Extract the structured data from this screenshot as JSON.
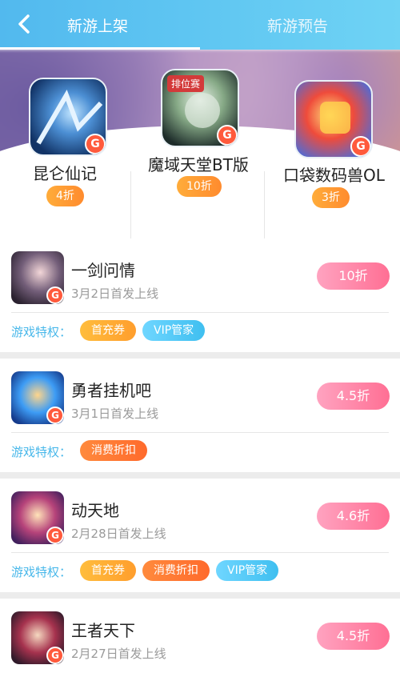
{
  "header": {
    "tabs": [
      "新游上架",
      "新游预告"
    ],
    "active_tab": 0
  },
  "featured": [
    {
      "name": "昆仑仙记",
      "discount": "4折",
      "badge": "G"
    },
    {
      "name": "魔域天堂BT版",
      "discount": "10折",
      "badge": "G",
      "tag": "排位赛"
    },
    {
      "name": "口袋数码兽OL",
      "discount": "3折",
      "badge": "G"
    }
  ],
  "cards": [
    {
      "name": "一剑问情",
      "date": "3月2日首发上线",
      "discount": "10折",
      "perk_label": "游戏特权：",
      "perks": [
        "首充券",
        "VIP管家"
      ]
    },
    {
      "name": "勇者挂机吧",
      "date": "3月1日首发上线",
      "discount": "4.5折",
      "perk_label": "游戏特权：",
      "perks": [
        "消费折扣"
      ]
    },
    {
      "name": "动天地",
      "date": "2月28日首发上线",
      "discount": "4.6折",
      "perk_label": "游戏特权：",
      "perks": [
        "首充券",
        "消费折扣",
        "VIP管家"
      ]
    },
    {
      "name": "王者天下",
      "date": "2月27日首发上线",
      "discount": "4.5折"
    }
  ],
  "colors": {
    "header_start": "#52b9ee",
    "pill_pink_start": "#ffa3c0",
    "pill_pink_end": "#ff6f94",
    "perk_orange": "#ffa52d",
    "perk_deep_orange": "#ff7a2f",
    "perk_blue": "#49c5f3",
    "perk_label": "#49b8ea"
  },
  "icons": {
    "back": "chevron-left-icon",
    "game_badge": "g-badge-icon"
  }
}
